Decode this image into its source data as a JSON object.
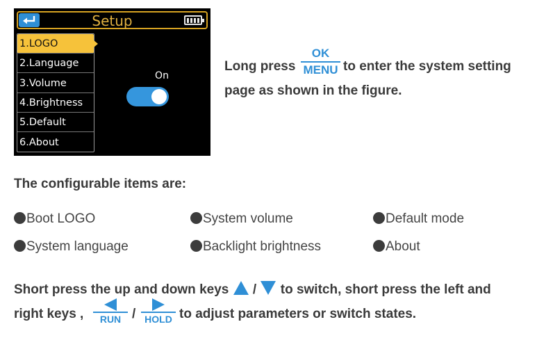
{
  "device": {
    "title": "Setup",
    "icons": {
      "back": "back-arrow-icon",
      "battery": "battery-full-icon"
    },
    "menu": [
      {
        "label": "1.LOGO",
        "selected": true
      },
      {
        "label": "2.Language",
        "selected": false
      },
      {
        "label": "3.Volume",
        "selected": false
      },
      {
        "label": "4.Brightness",
        "selected": false
      },
      {
        "label": "5.Default",
        "selected": false
      },
      {
        "label": "6.About",
        "selected": false
      }
    ],
    "toggle_label": "On",
    "toggle_state": true,
    "colors": {
      "accent_yellow": "#f6c23a",
      "accent_blue": "#3596dd",
      "screen_bg": "#000000"
    }
  },
  "intro": {
    "before": "Long press",
    "key_top": "OK",
    "key_bottom": "MENU",
    "after": "to enter the system setting",
    "line2": "page as shown in the figure."
  },
  "configurable": {
    "heading": "The configurable items are:",
    "items": [
      "Boot LOGO",
      "System volume",
      "Default mode",
      "System language",
      "Backlight brightness",
      "About"
    ]
  },
  "instructions": {
    "part1": "Short press the up and down keys",
    "slash": "/",
    "part2": "to switch, short press the left and",
    "part3": "right keys ,",
    "run_label": "RUN",
    "hold_label": "HOLD",
    "part4": "to adjust parameters or switch states.",
    "icons": [
      "up-triangle-icon",
      "down-triangle-icon",
      "left-triangle-icon",
      "right-triangle-icon"
    ]
  }
}
